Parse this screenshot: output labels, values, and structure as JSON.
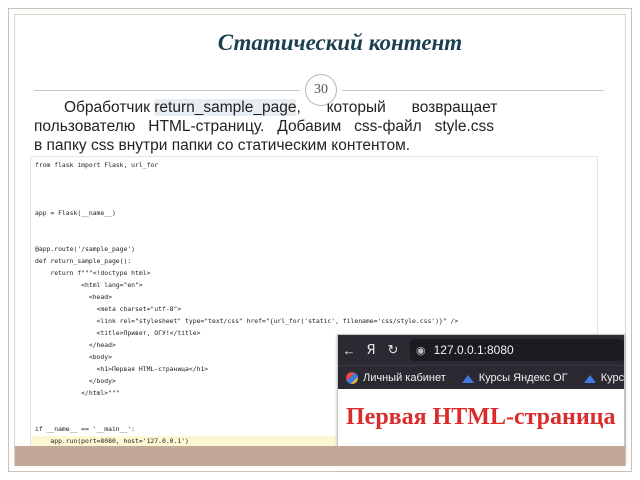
{
  "slide": {
    "title": "Статический контент",
    "page_number": "30",
    "body": {
      "line1_pre": "Обработчик ",
      "line1_highlight": "return_sample_page",
      "line1_post": ",      который      возвращает",
      "line2": "пользователю   HTML-страницу.   Добавим   css-файл   style.css",
      "line3": "в папку css внутри папки со статическим контентом."
    }
  },
  "code": {
    "lines": [
      "from flask import Flask, url_for",
      "",
      "",
      "",
      "app = Flask(__name__)",
      "",
      "",
      "@app.route('/sample_page')",
      "def return_sample_page():",
      "    return f\"\"\"<!doctype html>",
      "            <html lang=\"en\">",
      "              <head>",
      "                <meta charset=\"utf-8\">",
      "                <link rel=\"stylesheet\" type=\"text/css\" href=\"{url_for('static', filename='css/style.css')}\" />",
      "                <title>Привет, ОГУ!</title>",
      "              </head>",
      "              <body>",
      "                <h1>Первая HTML-страница</h1>",
      "              </body>",
      "            </html>\"\"\"",
      "",
      "",
      "if __name__ == '__main__':",
      "    app.run(port=8080, host='127.0.0.1')"
    ]
  },
  "browser": {
    "url": "127.0.0.1:8080",
    "bookmarks": [
      "Личный кабинет",
      "Курсы Яндекс ОГ",
      "Курс"
    ],
    "page_heading": "Первая HTML-страница"
  },
  "colors": {
    "title": "#1c3f50",
    "bottom_band": "#c2a896",
    "heading_red": "#d92d2d",
    "browser_chrome": "#2b2a33"
  }
}
